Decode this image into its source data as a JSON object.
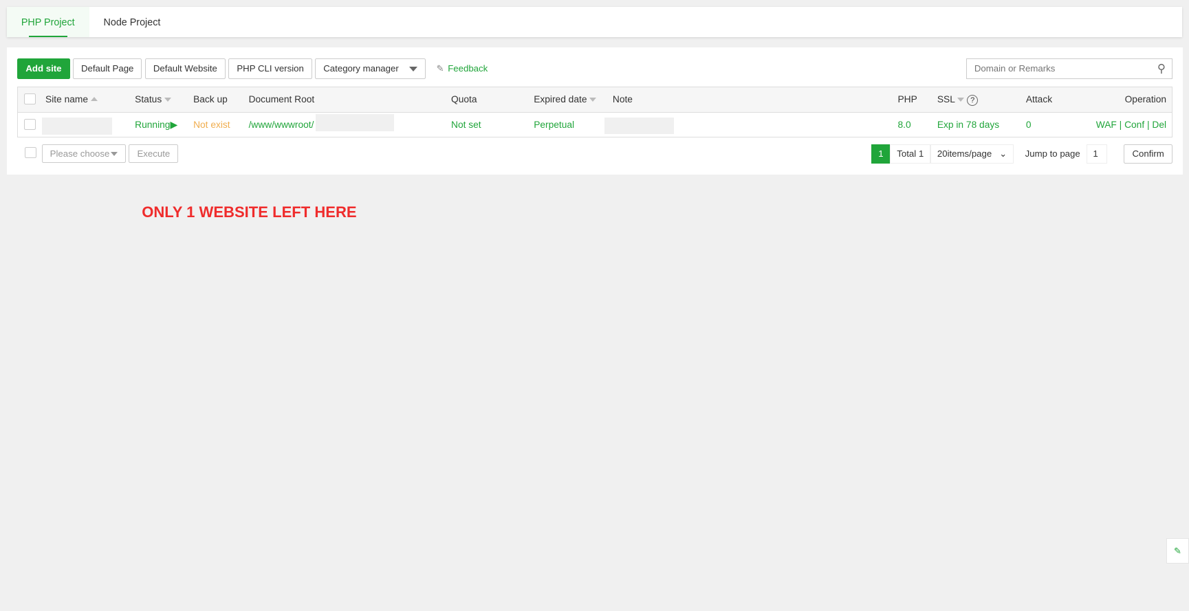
{
  "tabs": [
    "PHP Project",
    "Node Project"
  ],
  "toolbar": {
    "add_site": "Add site",
    "default_page": "Default Page",
    "default_website": "Default Website",
    "php_cli": "PHP CLI version",
    "category": "Category manager",
    "feedback": "Feedback",
    "search_placeholder": "Domain or Remarks"
  },
  "columns": {
    "site_name": "Site name",
    "status": "Status",
    "backup": "Back up",
    "doc_root": "Document Root",
    "quota": "Quota",
    "expired": "Expired date",
    "note": "Note",
    "php": "PHP",
    "ssl": "SSL",
    "attack": "Attack",
    "operation": "Operation"
  },
  "row": {
    "status": "Running",
    "backup": "Not exist",
    "doc_root": "/www/wwwroot/",
    "quota": "Not set",
    "expired": "Perpetual",
    "php": "8.0",
    "ssl": "Exp in 78 days",
    "attack": "0",
    "ops": [
      "WAF",
      "Conf",
      "Del"
    ]
  },
  "footer": {
    "batch_placeholder": "Please choose",
    "execute": "Execute",
    "page": "1",
    "total": "Total 1",
    "per_page": "20items/page",
    "jump": "Jump to page",
    "jump_value": "1",
    "confirm": "Confirm"
  },
  "notice": "ONLY 1 WEBSITE LEFT HERE"
}
